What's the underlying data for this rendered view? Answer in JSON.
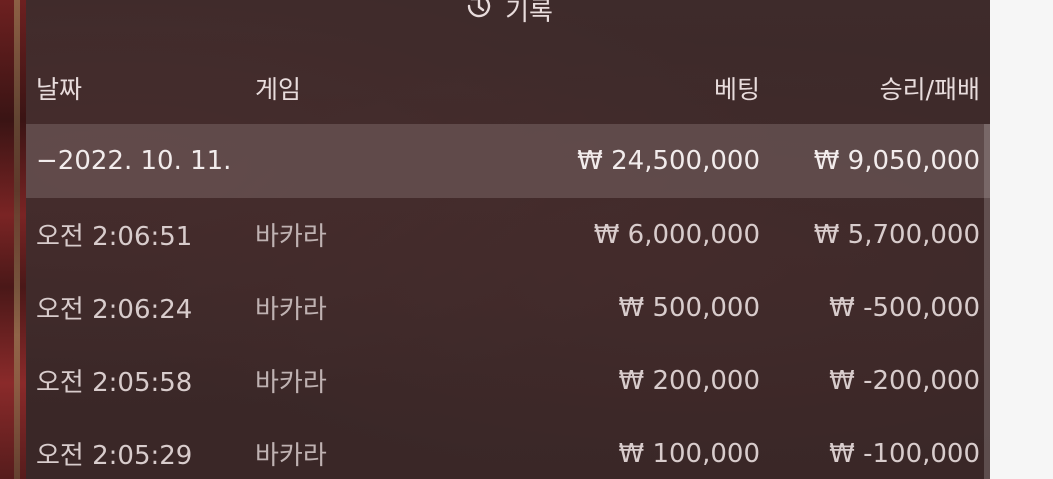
{
  "title": {
    "icon": "history-icon",
    "label": "기록"
  },
  "columns": {
    "date": "날짜",
    "game": "게임",
    "bet": "베팅",
    "win_loss": "승리/패배"
  },
  "summary": {
    "date": "−2022. 10. 11.",
    "bet": "₩ 24,500,000",
    "win_loss": "₩ 9,050,000"
  },
  "rows": [
    {
      "time": "오전 2:06:51",
      "game": "바카라",
      "bet": "₩ 6,000,000",
      "win_loss": "₩ 5,700,000"
    },
    {
      "time": "오전 2:06:24",
      "game": "바카라",
      "bet": "₩ 500,000",
      "win_loss": "₩ -500,000"
    },
    {
      "time": "오전 2:05:58",
      "game": "바카라",
      "bet": "₩ 200,000",
      "win_loss": "₩ -200,000"
    },
    {
      "time": "오전 2:05:29",
      "game": "바카라",
      "bet": "₩ 100,000",
      "win_loss": "₩ -100,000"
    }
  ]
}
